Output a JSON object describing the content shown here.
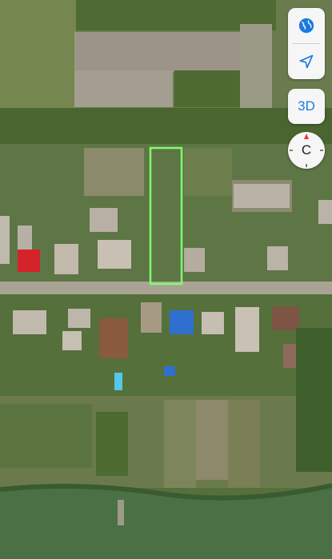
{
  "map": {
    "view": "satellite",
    "highlight_color": "#7dff6e"
  },
  "controls": {
    "globe_icon": "globe-icon",
    "location_icon": "location-arrow-icon",
    "three_d_label": "3D",
    "compass_label": "C",
    "accent": "#1a7ae0"
  }
}
